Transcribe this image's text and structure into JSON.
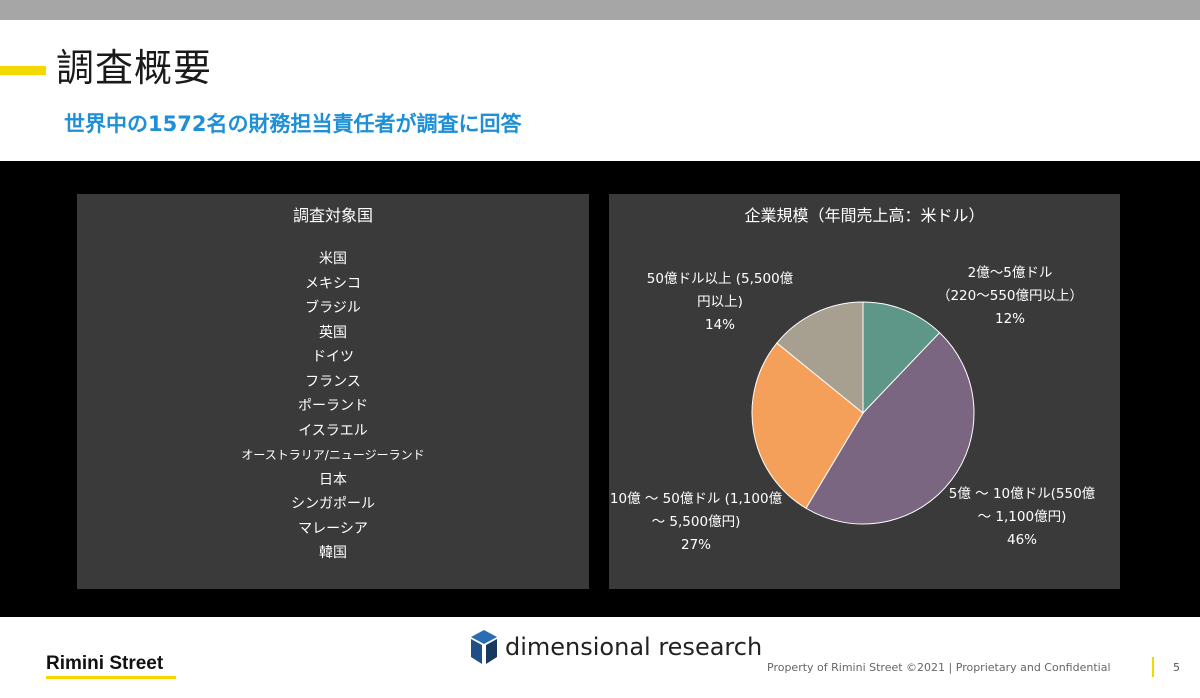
{
  "colors": {
    "top_bar": "#a6a6a6",
    "accent_yellow": "#f5d800",
    "subtitle_blue": "#1f8fd6",
    "content_background": "#000000",
    "panel_background": "#3a3a3a"
  },
  "slide": {
    "title": "調査概要",
    "subtitle": "世界中の1572名の財務担当責任者が調査に回答"
  },
  "countries_panel": {
    "title": "調査対象国",
    "countries": [
      "米国",
      "メキシコ",
      "ブラジル",
      "英国",
      "ドイツ",
      "フランス",
      "ポーランド",
      "イスラエル",
      "オーストラリア/ニュージーランド",
      "日本",
      "シンガポール",
      "マレーシア",
      "韓国"
    ]
  },
  "chart_data": {
    "type": "pie",
    "title": "企業規模（年間売上高：米ドル）",
    "slices": [
      {
        "label_lines": [
          "2億～5億ドル",
          "（220～550億円以上）"
        ],
        "value": 12,
        "percent_label": "12%",
        "color": "#5e9688"
      },
      {
        "label_lines": [
          "5億 ～ 10億ドル(550億",
          "～ 1,100億円)"
        ],
        "value": 46,
        "percent_label": "46%",
        "color": "#7a6680"
      },
      {
        "label_lines": [
          "10億 ～ 50億ドル (1,100億",
          "～ 5,500億円)"
        ],
        "value": 27,
        "percent_label": "27%",
        "color": "#f5a05a"
      },
      {
        "label_lines": [
          "50億ドル以上 (5,500億",
          "円以上)"
        ],
        "value": 14,
        "percent_label": "14%",
        "color": "#a79f8f"
      }
    ],
    "legend": "none",
    "data_labels": "outside"
  },
  "footer": {
    "company_logo": "Rimini Street",
    "partner_logo": "dimensional research",
    "partner_icon": "cube-icon",
    "note": "Property of Rimini Street ©2021  |  Proprietary and Confidential",
    "page_number": "5"
  }
}
